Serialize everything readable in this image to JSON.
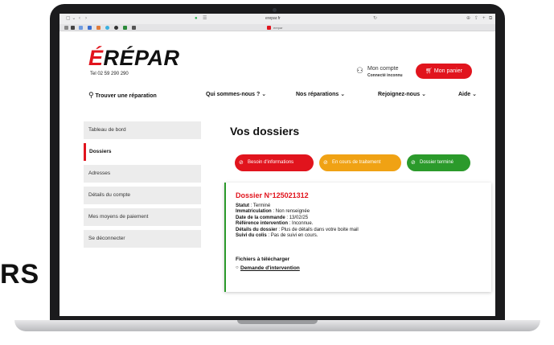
{
  "background_text": "RS",
  "browser": {
    "url": "erepar.fr",
    "tab_title": "erepar"
  },
  "header": {
    "logo_main": "RÉPAR",
    "logo_e": "É",
    "phone": "Tel 02 59 290 290",
    "account_label": "Mon compte",
    "account_status": "Connecté inconnu",
    "cart_label": "Mon panier"
  },
  "nav": {
    "find": "Trouver une réparation",
    "who": "Qui sommes-nous ?",
    "repairs": "Nos réparations",
    "join": "Rejoignez-nous",
    "help": "Aide"
  },
  "sidebar": {
    "items": [
      {
        "label": "Tableau de bord"
      },
      {
        "label": "Dossiers"
      },
      {
        "label": "Adresses"
      },
      {
        "label": "Détails du compte"
      },
      {
        "label": "Mes moyens de paiement"
      },
      {
        "label": "Se déconnecter"
      }
    ]
  },
  "main": {
    "title": "Vos dossiers",
    "filters": [
      {
        "label": "Besoin d'informations",
        "color": "#e1141d"
      },
      {
        "label": "En cours de traitement",
        "color": "#f0a214"
      },
      {
        "label": "Dossier terminé",
        "color": "#2b9a2b"
      }
    ]
  },
  "dossier": {
    "title": "Dossier N°125021312",
    "statut_label": "Statut",
    "statut_value": " : Terminé",
    "immat_label": "Immatriculation",
    "immat_value": " : Non renseignée",
    "date_label": "Date de la commande",
    "date_value": " : 13/02/25",
    "ref_label": "Référence intervention",
    "ref_value": " : Inconnue.",
    "details_label": "Détails du dossier",
    "details_value": " : Plus de détails dans votre boite mail",
    "suivi_label": "Suivi du colis",
    "suivi_value": " : Pas de suivi en cours.",
    "files_title": "Fichiers à télécharger",
    "file_link": "Demande d'intervention"
  },
  "colors": {
    "brand_red": "#e1141d",
    "status_green": "#2b9a2b",
    "status_orange": "#f0a214"
  }
}
